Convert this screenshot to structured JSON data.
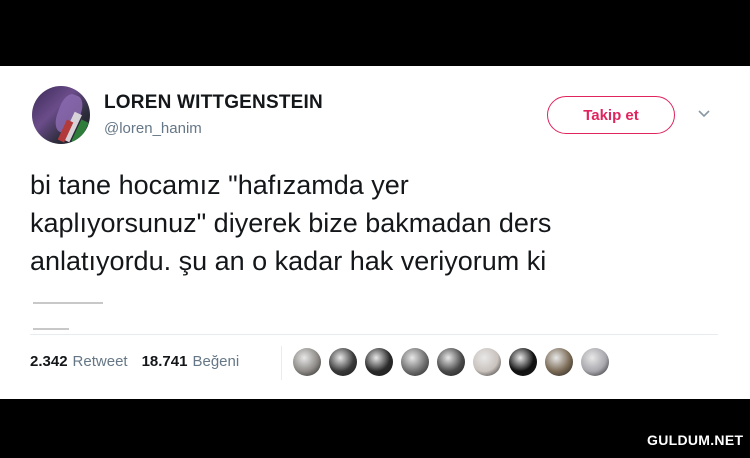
{
  "user": {
    "display_name": "LOREN WITTGENSTEIN",
    "handle": "@loren_hanim"
  },
  "follow_button": {
    "label": "Takip et"
  },
  "tweet": {
    "text": "bi tane hocamız \"hafızamda yer\nkaplıyorsunuz\" diyerek bize bakmadan ders\nanlatıyordu. şu an o kadar hak veriyorum ki"
  },
  "stats": {
    "retweet_count": "2.342",
    "retweet_label": "Retweet",
    "like_count": "18.741",
    "like_label": "Beğeni"
  },
  "likers": [
    {
      "icon": "avatar",
      "color": "#8d8a86"
    },
    {
      "icon": "avatar",
      "color": "#3a3a3a"
    },
    {
      "icon": "avatar",
      "color": "#2a2a2a"
    },
    {
      "icon": "avatar",
      "color": "#6f6f6f"
    },
    {
      "icon": "avatar",
      "color": "#4b4b4b"
    },
    {
      "icon": "avatar",
      "color": "#c9c2bd"
    },
    {
      "icon": "avatar",
      "color": "#111111"
    },
    {
      "icon": "avatar",
      "color": "#7a6a55"
    },
    {
      "icon": "avatar",
      "color": "#a7a7ad"
    }
  ],
  "watermark": "GULDUM.NET",
  "colors": {
    "accent": "#e0245e",
    "text": "#14171a",
    "muted": "#657786"
  }
}
